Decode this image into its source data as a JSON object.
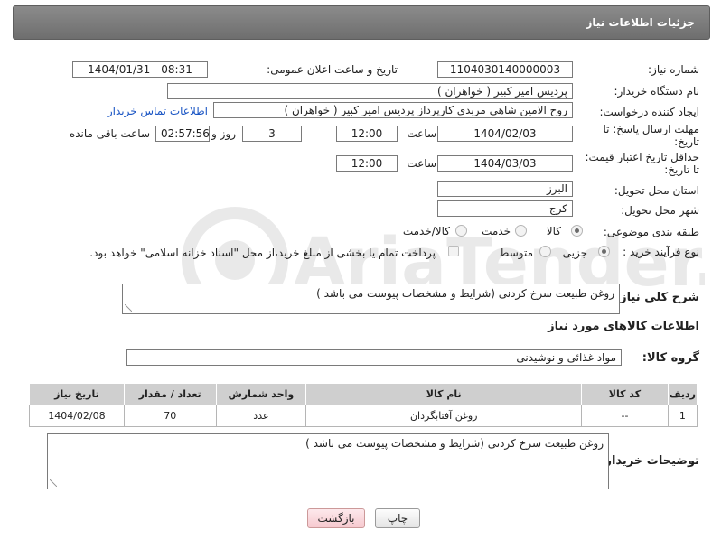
{
  "header": {
    "title": "جزئیات اطلاعات نیاز"
  },
  "fields": {
    "need_number_label": "شماره نیاز:",
    "need_number": "1104030140000003",
    "announce_label": "تاریخ و ساعت اعلان عمومی:",
    "announce_value": "1404/01/31 - 08:31",
    "buyer_org_label": "نام دستگاه خریدار:",
    "buyer_org": "پردیس امیر کبیر ( خواهران )",
    "creator_label": "ایجاد کننده درخواست:",
    "creator": "روح الامین شاهی مربدی کارپرداز پردیس امیر کبیر ( خواهران )",
    "buyer_contact_link": "اطلاعات تماس خریدار",
    "deadline_label_1": "مهلت ارسال پاسخ: تا",
    "deadline_label_2": "تاریخ:",
    "deadline_date": "1404/02/03",
    "time_label": "ساعت",
    "deadline_time": "12:00",
    "days_value": "3",
    "days_label": "روز و",
    "remaining_time": "02:57:56",
    "remaining_label": "ساعت باقی مانده",
    "validity_label_1": "حداقل تاریخ اعتبار قیمت:",
    "validity_label_2": "تا تاریخ:",
    "validity_date": "1404/03/03",
    "validity_time": "12:00",
    "province_label": "استان محل تحویل:",
    "province": "البرز",
    "city_label": "شهر محل تحویل:",
    "city": "کرج",
    "category_label": "طبقه بندی موضوعی:",
    "category_options": [
      "کالا",
      "خدمت",
      "کالا/خدمت"
    ],
    "category_selected": "کالا",
    "process_label": "نوع فرآیند خرید :",
    "process_options": [
      "جزیی",
      "متوسط"
    ],
    "process_selected": "جزیی",
    "payment_note": "پرداخت تمام یا بخشی از مبلغ خرید،از محل \"اسناد خزانه اسلامی\" خواهد بود."
  },
  "description": {
    "label": "شرح کلی نیاز:",
    "value": "روغن طبیعت سرخ کردنی (شرایط و مشخصات پیوست می باشد )"
  },
  "items_section": {
    "title": "اطلاعات کالاهای مورد نیاز",
    "group_label": "گروه کالا:",
    "group_value": "مواد غذائی و نوشیدنی",
    "columns": [
      "ردیف",
      "کد کالا",
      "نام کالا",
      "واحد شمارش",
      "تعداد / مقدار",
      "تاریخ نیاز"
    ],
    "rows": [
      [
        "1",
        "--",
        "روغن آفتابگردان",
        "عدد",
        "70",
        "1404/02/08"
      ]
    ]
  },
  "buyer_notes": {
    "label": "توضیحات خریدار:",
    "value": "روغن طبیعت سرخ کردنی (شرایط و مشخصات پیوست می باشد )"
  },
  "buttons": {
    "print": "چاپ",
    "back": "بازگشت"
  },
  "watermark_text": "AriaTender.neT"
}
